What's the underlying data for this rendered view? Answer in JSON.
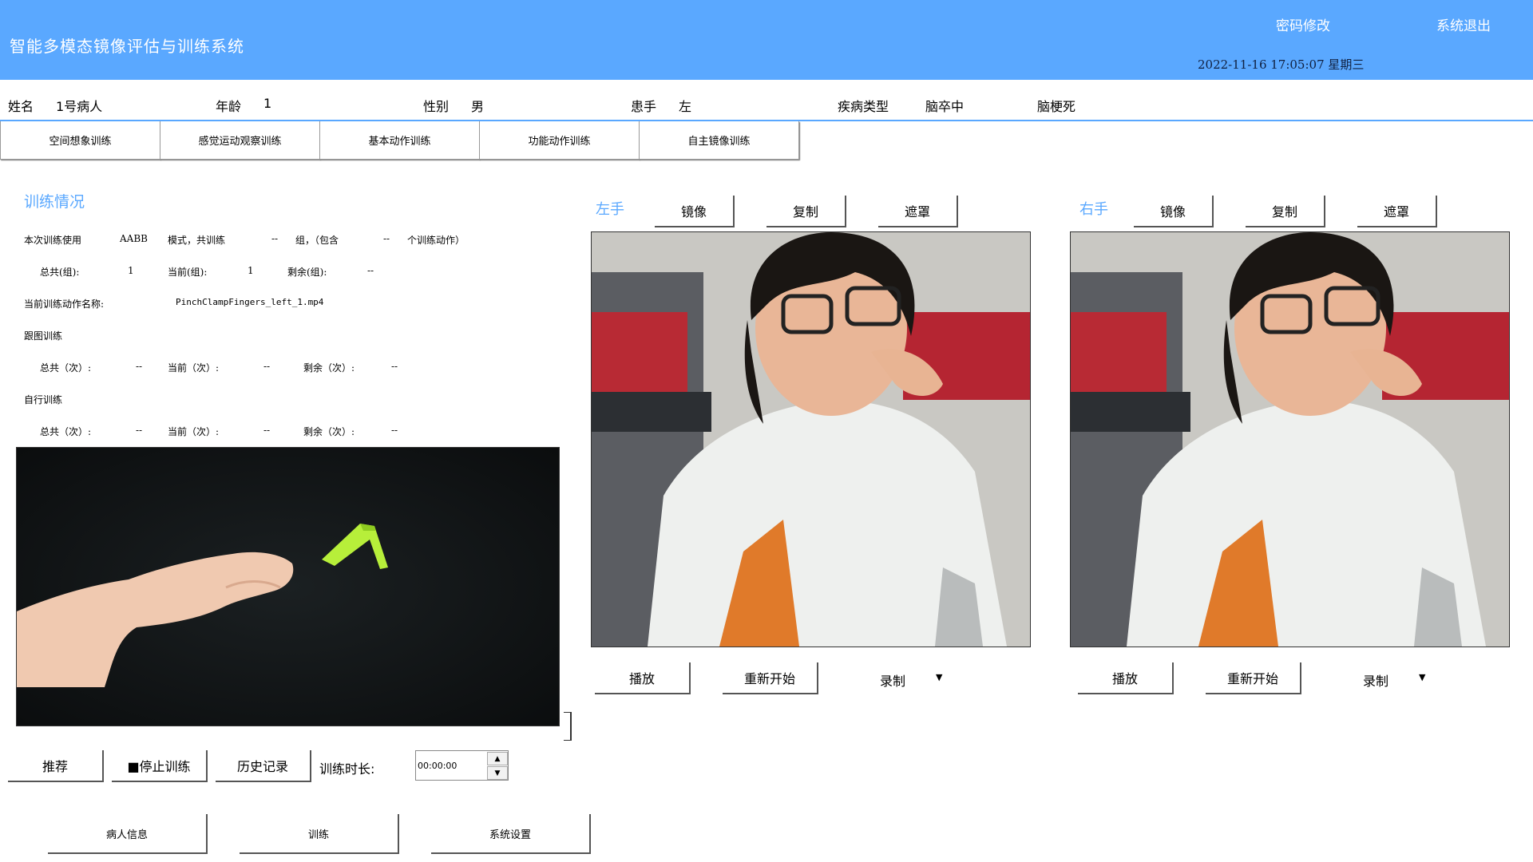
{
  "header": {
    "title": "智能多模态镜像评估与训练系统",
    "change_password": "密码修改",
    "logout": "系统退出",
    "datetime": "2022-11-16 17:05:07 星期三"
  },
  "patient": {
    "name_label": "姓名",
    "name": "1号病人",
    "age_label": "年龄",
    "age": "1",
    "gender_label": "性别",
    "gender": "男",
    "hand_label": "患手",
    "hand": "左",
    "disease_label": "疾病类型",
    "disease": "脑卒中",
    "disease_sub": "脑梗死"
  },
  "tabs": [
    "空间想象训练",
    "感觉运动观察训练",
    "基本动作训练",
    "功能动作训练",
    "自主镜像训练"
  ],
  "training": {
    "title": "训练情况",
    "line1": {
      "prefix": "本次训练使用",
      "mode": "AABB",
      "mid": "模式，共训练",
      "groups": "--",
      "mid2": "组，（包含",
      "actions": "--",
      "suffix": "个训练动作）"
    },
    "line2": {
      "total_label": "总共(组):",
      "total": "1",
      "current_label": "当前(组):",
      "current": "1",
      "remain_label": "剩余(组):",
      "remain": "--"
    },
    "action_name_label": "当前训练动作名称:",
    "action_name": "PinchClampFingers_left_1.mp4",
    "follow_title": "跟图训练",
    "follow": {
      "total_label": "总共（次）:",
      "total": "--",
      "current_label": "当前（次）:",
      "current": "--",
      "remain_label": "剩余（次）:",
      "remain": "--"
    },
    "self_title": "自行训练",
    "self": {
      "total_label": "总共（次）:",
      "total": "--",
      "current_label": "当前（次）:",
      "current": "--",
      "remain_label": "剩余（次）:",
      "remain": "--"
    }
  },
  "controls": {
    "recommend": "推荐",
    "stop": "■停止训练",
    "history": "历史记录",
    "duration_label": "训练时长:",
    "duration_value": "00:00:00",
    "spin_up": "▲",
    "spin_down": "▼"
  },
  "bottom_nav": [
    "病人信息",
    "训练",
    "系统设置"
  ],
  "left_panel": {
    "label": "左手",
    "mirror": "镜像",
    "copy": "复制",
    "mask": "遮罩",
    "play": "播放",
    "restart": "重新开始",
    "record": "录制",
    "dropdown": "▼"
  },
  "right_panel": {
    "label": "右手",
    "mirror": "镜像",
    "copy": "复制",
    "mask": "遮罩",
    "play": "播放",
    "restart": "重新开始",
    "record": "录制",
    "dropdown": "▼"
  },
  "colors": {
    "header": "#5aa8ff",
    "accent": "#5aa8ff"
  }
}
